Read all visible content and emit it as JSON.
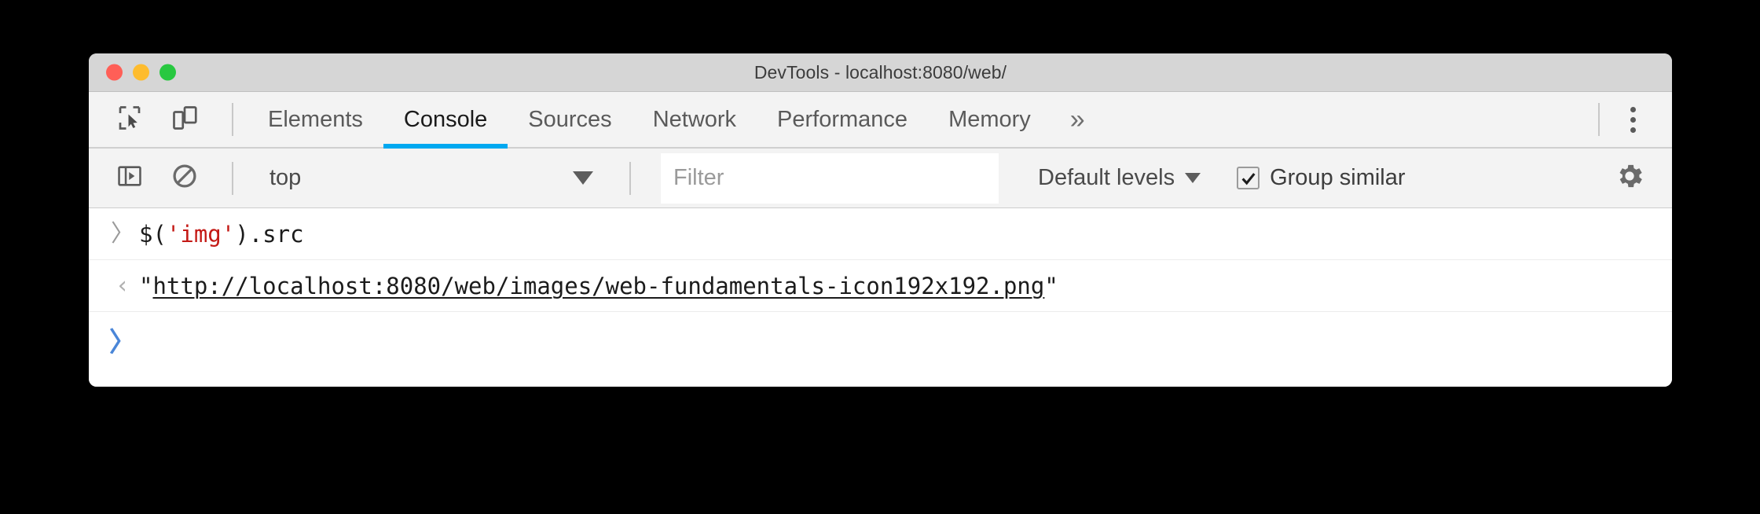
{
  "window": {
    "title": "DevTools - localhost:8080/web/",
    "traffic_lights": [
      "close",
      "minimize",
      "maximize"
    ],
    "colors": {
      "close": "#ff5f57",
      "minimize": "#febc2e",
      "maximize": "#28c840",
      "accent": "#00a8f0",
      "titlebar_bg": "#d6d6d6",
      "toolbar_bg": "#f3f3f3",
      "string_red": "#c41a16",
      "prompt_blue": "#4a86d8"
    }
  },
  "tabbar": {
    "inspect_icon": "inspect-element-icon",
    "device_icon": "device-toolbar-icon",
    "tabs": [
      {
        "label": "Elements",
        "active": false
      },
      {
        "label": "Console",
        "active": true
      },
      {
        "label": "Sources",
        "active": false
      },
      {
        "label": "Network",
        "active": false
      },
      {
        "label": "Performance",
        "active": false
      },
      {
        "label": "Memory",
        "active": false
      }
    ],
    "overflow_label": "»",
    "more_icon": "more-vertical-icon"
  },
  "console_toolbar": {
    "sidebar_icon": "console-sidebar-icon",
    "clear_icon": "clear-console-icon",
    "context": {
      "value": "top",
      "caret": "chevron-down-icon"
    },
    "filter": {
      "value": "",
      "placeholder": "Filter"
    },
    "levels": {
      "label": "Default levels",
      "caret": "chevron-down-icon"
    },
    "group_similar": {
      "label": "Group similar",
      "checked": true
    },
    "settings_icon": "gear-icon"
  },
  "console": {
    "rows": [
      {
        "type": "input",
        "gutter": "〉",
        "code_prefix": "$(",
        "code_string": "'img'",
        "code_suffix": ").src"
      },
      {
        "type": "result",
        "gutter": "‹",
        "quote_open": "\"",
        "url": "http://localhost:8080/web/images/web-fundamentals-icon192x192.png",
        "quote_close": "\""
      },
      {
        "type": "prompt",
        "gutter": "〉"
      }
    ]
  }
}
